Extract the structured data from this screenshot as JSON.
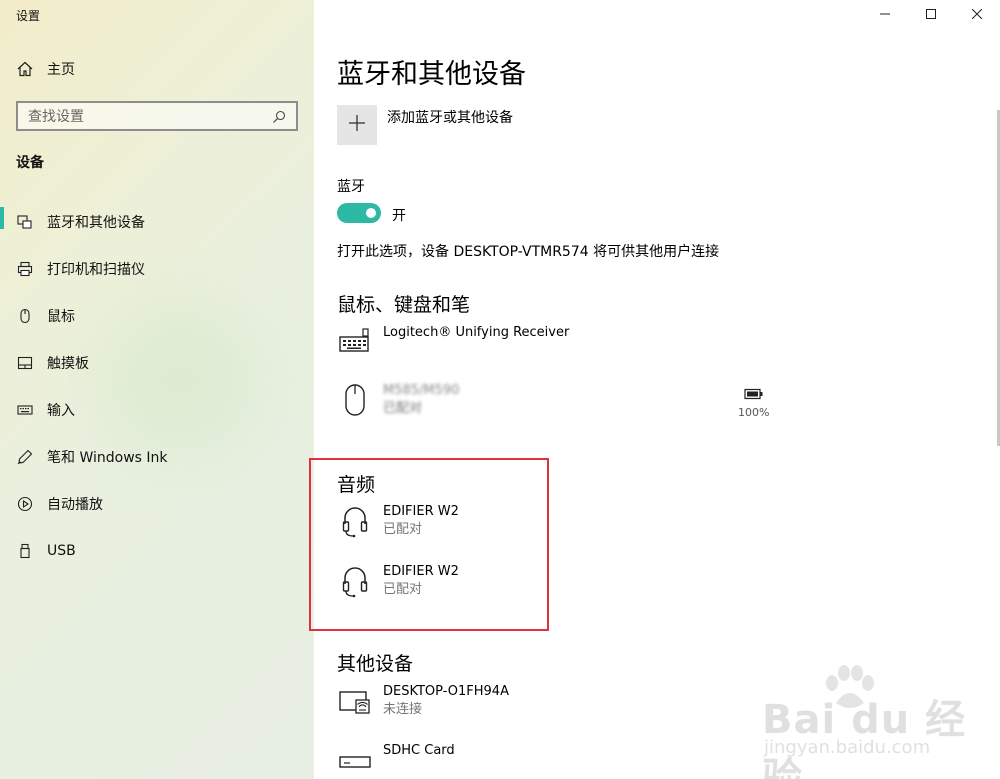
{
  "app": {
    "title": "设置"
  },
  "sidebar": {
    "home_label": "主页",
    "search_placeholder": "查找设置",
    "section_label": "设备",
    "items": [
      {
        "label": "蓝牙和其他设备",
        "icon": "bluetooth-devices-icon",
        "active": true
      },
      {
        "label": "打印机和扫描仪",
        "icon": "printer-icon"
      },
      {
        "label": "鼠标",
        "icon": "mouse-icon"
      },
      {
        "label": "触摸板",
        "icon": "touchpad-icon"
      },
      {
        "label": "输入",
        "icon": "keyboard-icon"
      },
      {
        "label": "笔和 Windows Ink",
        "icon": "pen-icon"
      },
      {
        "label": "自动播放",
        "icon": "autoplay-icon"
      },
      {
        "label": "USB",
        "icon": "usb-icon"
      }
    ]
  },
  "main": {
    "title": "蓝牙和其他设备",
    "add_device_label": "添加蓝牙或其他设备",
    "bluetooth": {
      "label": "蓝牙",
      "state": "开",
      "description": "打开此选项，设备 DESKTOP-VTMR574 将可供其他用户连接"
    },
    "sections": {
      "input": {
        "heading": "鼠标、键盘和笔",
        "devices": [
          {
            "name": "Logitech® Unifying Receiver",
            "status": ""
          },
          {
            "name": "M585/M590",
            "status": "已配对",
            "battery": "100%"
          }
        ]
      },
      "audio": {
        "heading": "音频",
        "devices": [
          {
            "name": "EDIFIER W2",
            "status": "已配对"
          },
          {
            "name": "EDIFIER W2",
            "status": "已配对"
          }
        ]
      },
      "other": {
        "heading": "其他设备",
        "devices": [
          {
            "name": "DESKTOP-O1FH94A",
            "status": "未连接"
          },
          {
            "name": "SDHC Card",
            "status": ""
          }
        ]
      }
    }
  },
  "watermark": {
    "main": "Bai du 经验",
    "sub": "jingyan.baidu.com"
  },
  "colors": {
    "accent": "#2cb9a6",
    "highlight": "#e0323a"
  }
}
